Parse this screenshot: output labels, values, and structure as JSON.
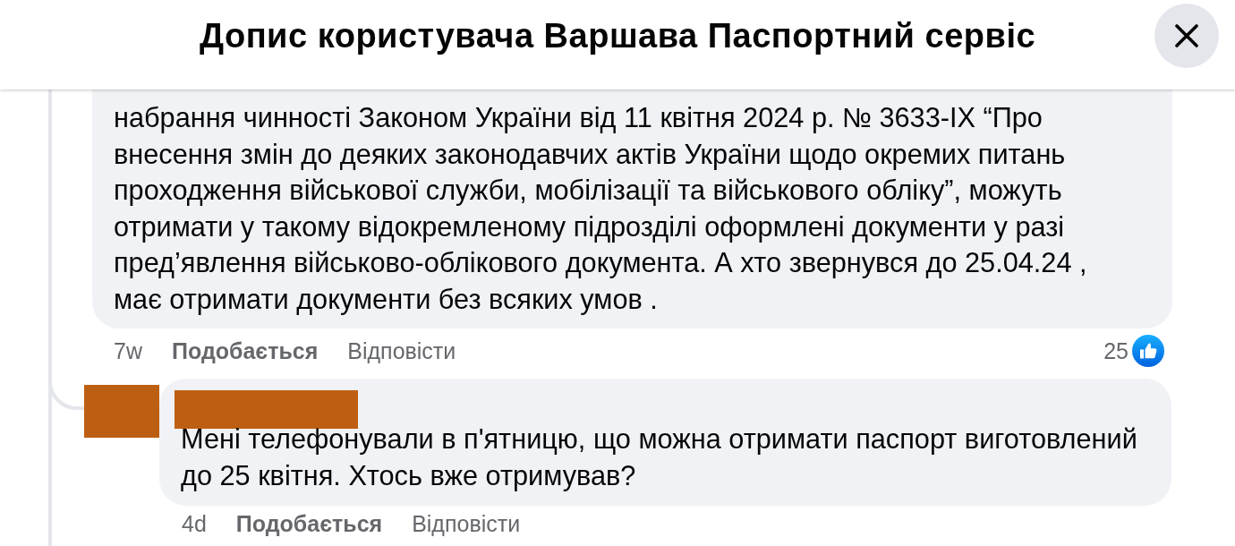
{
  "header": {
    "title": "Допис користувача Варшава Паспортний сервіс"
  },
  "comments": [
    {
      "kind": "comment",
      "text": "набрання чинності Законом України від 11 квітня 2024 р. № 3633-IX “Про внесення змін до деяких законодавчих актів України щодо окремих питань проходження військової служби, мобілізації та військового обліку”, можуть отримати у такому відокремленому підрозділі оформлені документи у разі пред’явлення військово-облікового документа. А хто звернувся до 25.04.24 , має отримати документи без всяких умов .",
      "time": "7w",
      "like_label": "Подобається",
      "reply_label": "Відповісти",
      "reaction_count": "25"
    },
    {
      "kind": "reply",
      "text": "Мені телефонували в п'ятницю, що можна отримати паспорт виготовлений до 25 квітня. Хтось вже отримував?",
      "time": "4d",
      "like_label": "Подобається",
      "reply_label": "Відповісти"
    }
  ]
}
